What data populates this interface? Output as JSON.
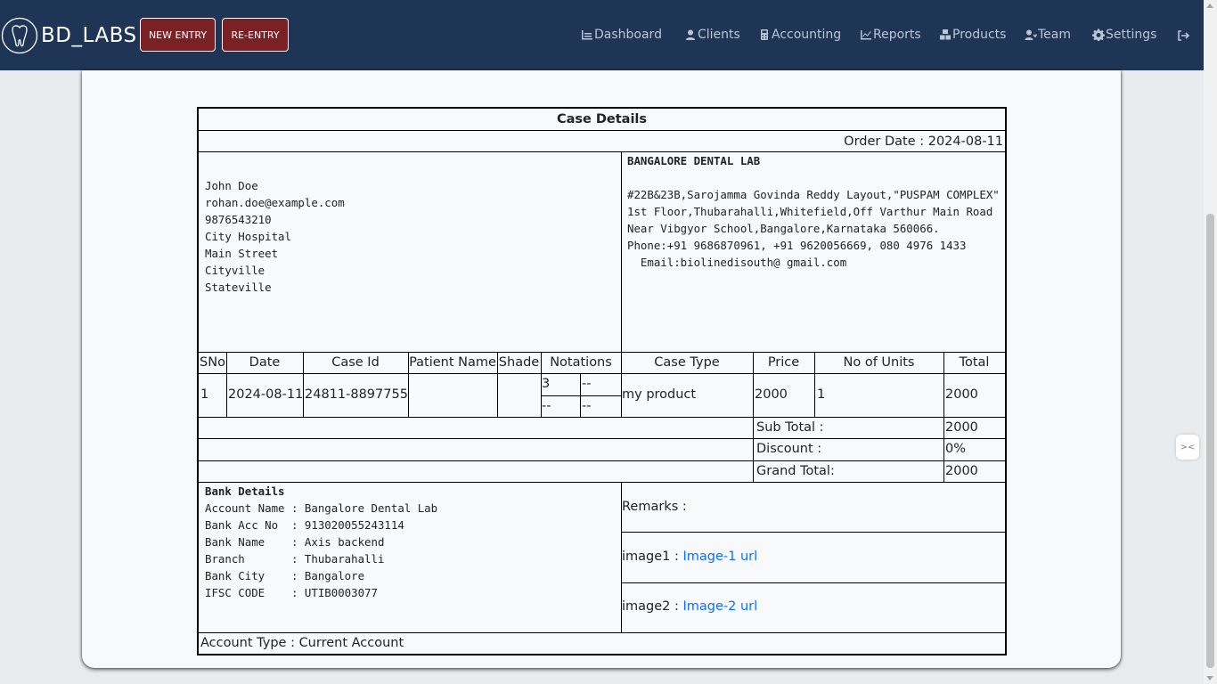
{
  "navbar": {
    "brand": "BD_LABS",
    "new_entry": "NEW ENTRY",
    "re_entry": "RE-ENTRY",
    "links": [
      {
        "label": "Dashboard",
        "icon": "dashboard-icon"
      },
      {
        "label": "Clients",
        "icon": "user-icon"
      },
      {
        "label": "Accounting",
        "icon": "calculator-icon"
      },
      {
        "label": "Reports",
        "icon": "chart-icon"
      },
      {
        "label": "Products",
        "icon": "boxes-icon"
      },
      {
        "label": "Team",
        "icon": "team-icon"
      },
      {
        "label": "Settings",
        "icon": "gear-icon"
      }
    ],
    "logout_icon": "logout-icon"
  },
  "case": {
    "title": "Case Details",
    "order_date": "Order Date : 2024-08-11",
    "client_lines": [
      "John Doe",
      "rohan.doe@example.com",
      "9876543210",
      "City Hospital",
      "Main Street",
      "Cityville",
      "Stateville"
    ],
    "lab_name": "BANGALORE DENTAL LAB",
    "lab_lines": [
      "#22B&23B,Sarojamma Govinda Reddy Layout,\"PUSPAM COMPLEX\"",
      "1st Floor,Thubarahalli,Whitefield,Off Varthur Main Road",
      "Near Vibgyor School,Bangalore,Karnataka 560066.",
      "Phone:+91 9686870961, +91 9620056669, 080 4976 1433",
      "  Email:biolinedisouth@ gmail.com"
    ],
    "columns": [
      "SNo",
      "Date",
      "Case Id",
      "Patient Name",
      "Shade",
      "Notations",
      "Case Type",
      "Price",
      "No of Units",
      "Total"
    ],
    "row": {
      "sno": "1",
      "date": "2024-08-11",
      "case_id": "24811-8897755",
      "patient_name": "",
      "shade": "",
      "notations": [
        "3",
        "--",
        "--",
        "--"
      ],
      "case_type": "my product",
      "price": "2000",
      "units": "1",
      "total": "2000"
    },
    "summary": {
      "sub_total_label": "Sub Total :",
      "sub_total": "2000",
      "discount_label": "Discount :",
      "discount": "0%",
      "grand_total_label": "Grand Total:",
      "grand_total": "2000"
    },
    "bank": {
      "title": "Bank Details",
      "lines": [
        "Account Name : Bangalore Dental Lab",
        "Bank Acc No  : 913020055243114",
        "Bank Name    : Axis backend",
        "Branch       : Thubarahalli",
        "Bank City    : Bangalore",
        "IFSC CODE    : UTIB0003077"
      ]
    },
    "remarks_label": "Remarks :",
    "image1_label": "image1 : ",
    "image1_link": "Image-1 url",
    "image2_label": "image2 : ",
    "image2_link": "Image-2 url",
    "account_type": "Account Type : Current Account"
  }
}
